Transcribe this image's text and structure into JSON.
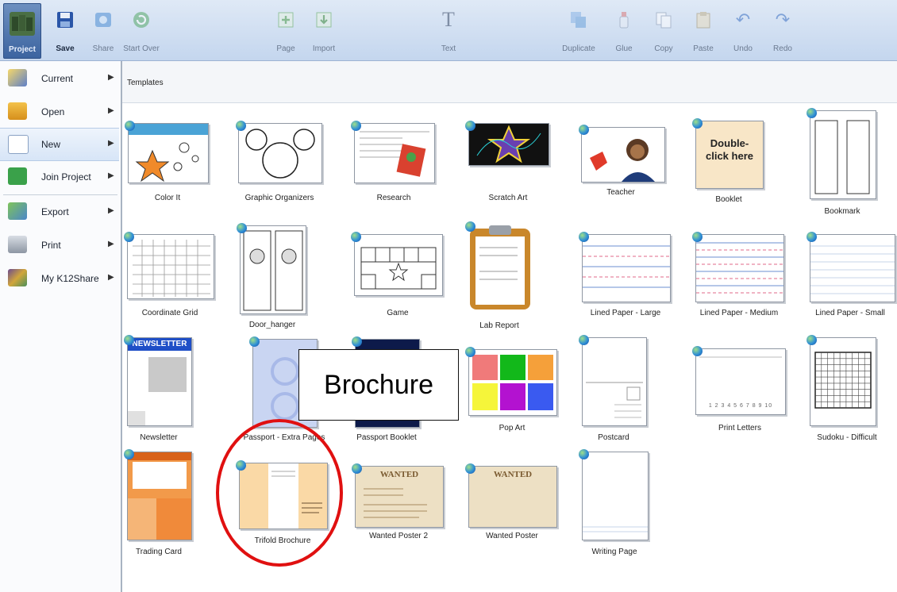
{
  "toolbar": {
    "project": "Project",
    "save": "Save",
    "share": "Share",
    "start_over": "Start Over",
    "page": "Page",
    "import": "Import",
    "text": "Text",
    "duplicate": "Duplicate",
    "glue": "Glue",
    "copy": "Copy",
    "paste": "Paste",
    "undo": "Undo",
    "redo": "Redo"
  },
  "sidebar": {
    "items": [
      {
        "label": "Current"
      },
      {
        "label": "Open"
      },
      {
        "label": "New"
      },
      {
        "label": "Join Project"
      },
      {
        "label": "Export"
      },
      {
        "label": "Print"
      },
      {
        "label": "My K12Share"
      }
    ]
  },
  "header": {
    "title": "Templates"
  },
  "templates": [
    "Color It",
    "Graphic Organizers",
    "Research",
    "Scratch Art",
    "Teacher",
    "Booklet",
    "Bookmark",
    "Coordinate Grid",
    "Door_hanger",
    "Game",
    "Lab Report",
    "Lined Paper - Large",
    "Lined Paper - Medium",
    "Lined Paper - Small",
    "Newsletter",
    "Passport - Extra Pages",
    "Passport Booklet",
    "Pop Art",
    "Postcard",
    "Print Letters",
    "Sudoku - Difficult",
    "Trading Card",
    "Trifold Brochure",
    "Wanted Poster 2",
    "Wanted Poster",
    "Writing Page"
  ],
  "thumb_text": {
    "booklet": "Double-click here",
    "newsletter": "NEWSLETTER",
    "wanted": "WANTED",
    "print_letters": "1 2 3 4 5 6 7 8 9 10"
  },
  "annotation": {
    "label": "Brochure",
    "circle_color": "#e01010"
  },
  "colors": {
    "accent": "#3c64a0",
    "toolbar": "#c4d6ee"
  }
}
